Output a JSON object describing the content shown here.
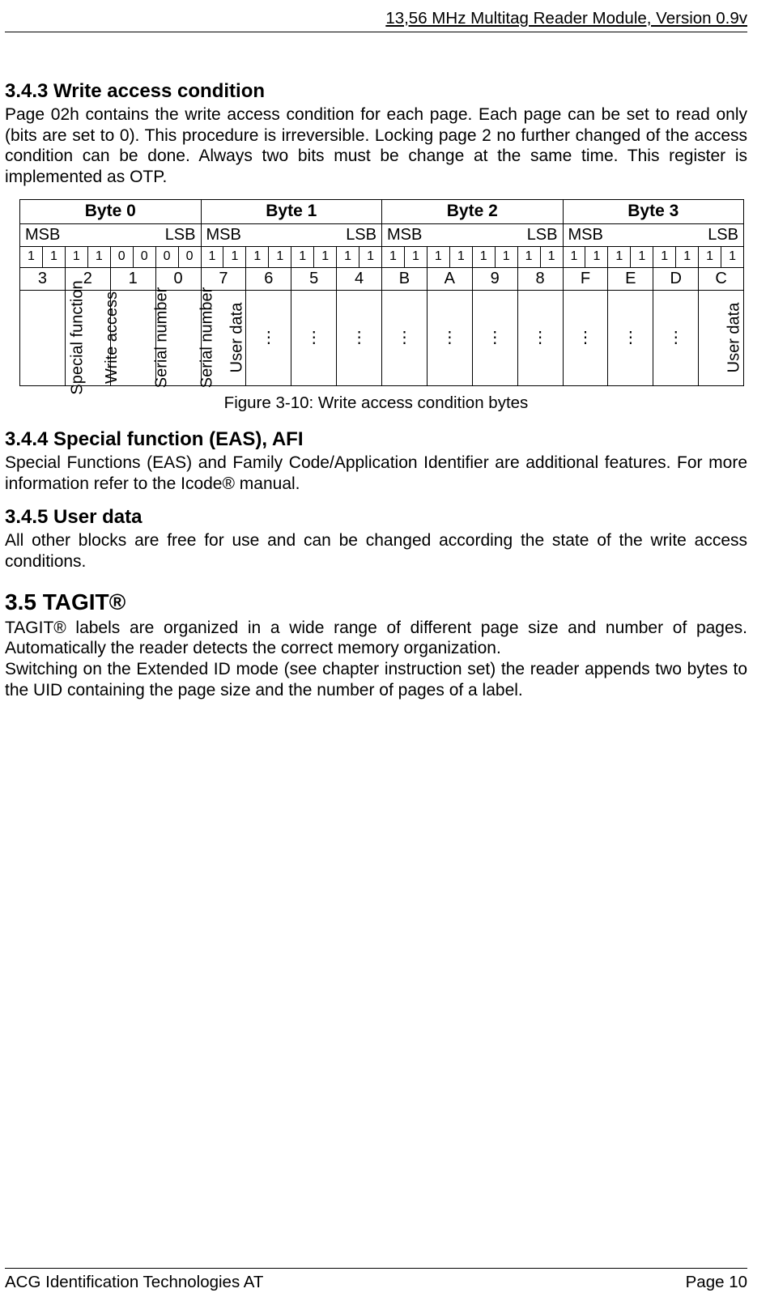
{
  "header": {
    "title": "13,56 MHz Multitag Reader Module, Version 0.9v"
  },
  "s343": {
    "heading": "3.4.3 Write access condition",
    "para": "Page 02h contains the write access condition for each page. Each page can be set to read only (bits are set to 0). This procedure is irreversible. Locking page 2 no further changed of the access condition can be done. Always two bits must be change at the same time. This register is implemented as OTP."
  },
  "table": {
    "byte_headers": [
      "Byte 0",
      "Byte 1",
      "Byte 2",
      "Byte 3"
    ],
    "msblsb": {
      "msb": "MSB",
      "lsb": "LSB"
    },
    "bits": [
      "1",
      "1",
      "1",
      "1",
      "0",
      "0",
      "0",
      "0",
      "1",
      "1",
      "1",
      "1",
      "1",
      "1",
      "1",
      "1",
      "1",
      "1",
      "1",
      "1",
      "1",
      "1",
      "1",
      "1",
      "1",
      "1",
      "1",
      "1",
      "1",
      "1",
      "1",
      "1"
    ],
    "nibbles": [
      "3",
      "2",
      "1",
      "0",
      "7",
      "6",
      "5",
      "4",
      "B",
      "A",
      "9",
      "8",
      "F",
      "E",
      "D",
      "C"
    ],
    "labels": [
      "Special\nfunction",
      "Write\naccess",
      "Serial\nnumber",
      "Serial\nnumber",
      "User\ndata",
      "⋮",
      "⋮",
      "⋮",
      "⋮",
      "⋮",
      "⋮",
      "⋮",
      "⋮",
      "⋮",
      "⋮",
      "User\ndata"
    ],
    "caption": "Figure 3-10: Write access condition bytes"
  },
  "s344": {
    "heading": "3.4.4 Special function (EAS), AFI",
    "para": "Special Functions (EAS) and Family Code/Application Identifier are additional features. For more information refer to the Icode® manual."
  },
  "s345": {
    "heading": "3.4.5 User data",
    "para": "All other blocks are free for use and can be changed according the state of the write access conditions."
  },
  "s35": {
    "heading": "3.5 TAGIT®",
    "para1": "TAGIT® labels are organized in a wide range of different page size and number of pages. Automatically the reader detects the correct memory organization.",
    "para2": "Switching on the Extended ID mode (see chapter instruction set) the reader appends two bytes to the UID containing the page size and the number of pages of a label."
  },
  "footer": {
    "left": "ACG Identification Technologies AT",
    "right": "Page 10"
  }
}
